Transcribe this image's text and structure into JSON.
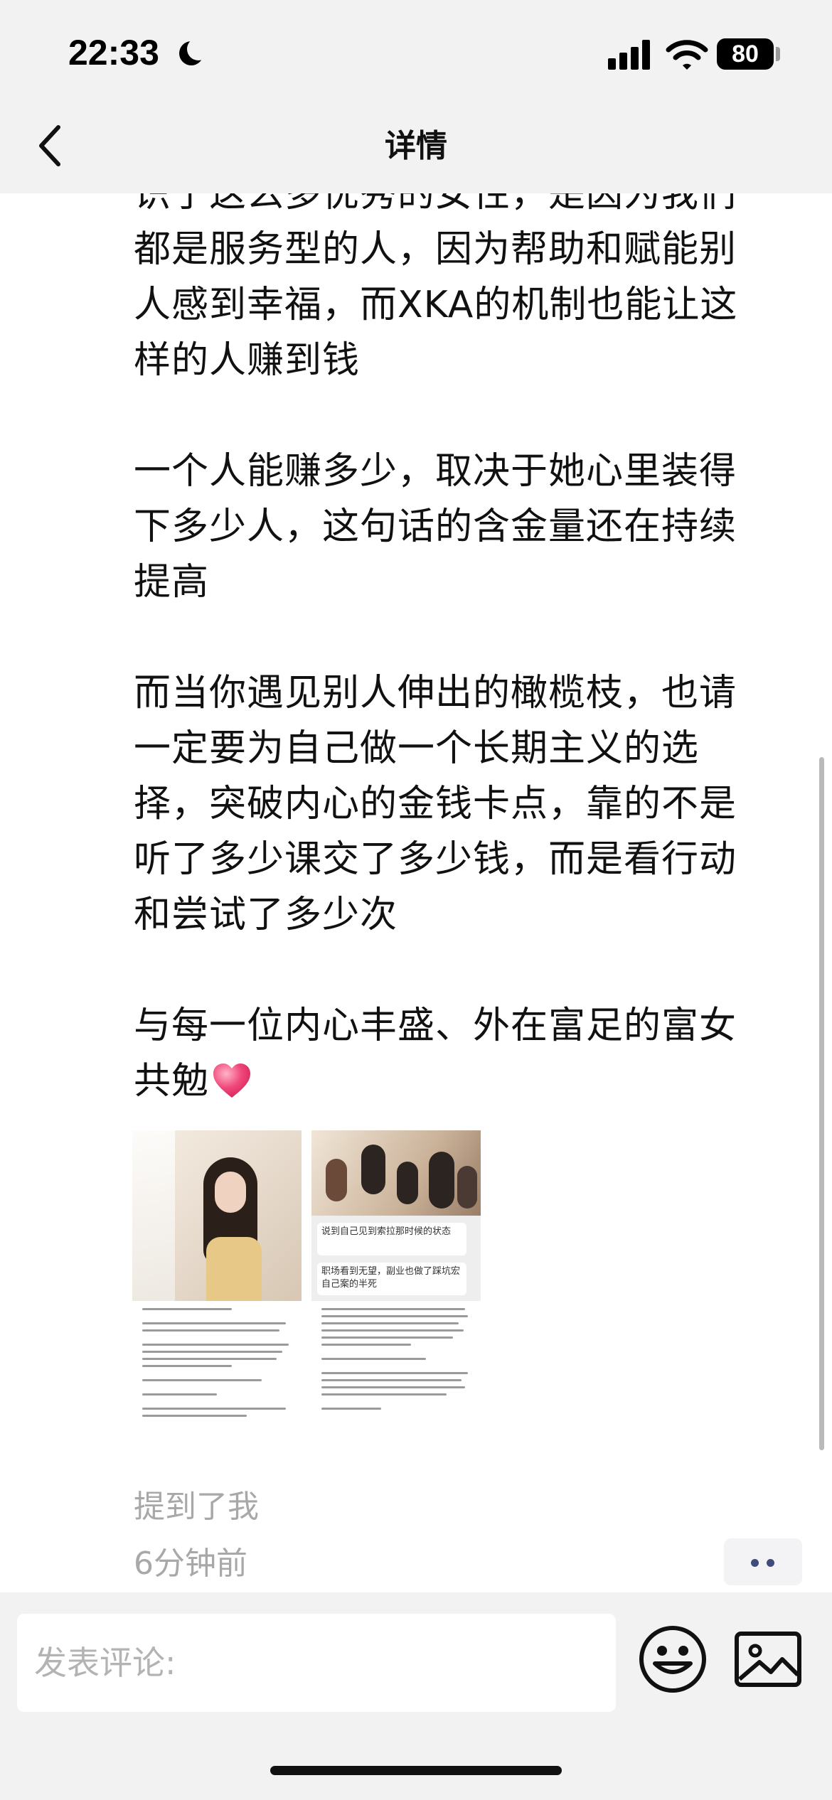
{
  "status_bar": {
    "time": "22:33",
    "battery": "80",
    "icons": [
      "moon-icon",
      "signal-icon",
      "wifi-icon",
      "battery-icon"
    ]
  },
  "header": {
    "title": "详情",
    "back_icon": "chevron-left-icon"
  },
  "post": {
    "paragraphs": [
      "识了这么多优秀的女性，是因为我们\n都是服务型的人，因为帮助和赋能别\n人感到幸福，而XKA的机制也能让这\n样的人赚到钱",
      "一个人能赚多少，取决于她心里装得\n下多少人，这句话的含金量还在持续\n提高",
      "而当你遇见别人伸出的橄榄枝，也请\n一定要为自己做一个长期主义的选\n择，突破内心的金钱卡点，靠的不是\n听了多少课交了多少钱，而是看行动\n和尝试了多少次",
      "与每一位内心丰盛、外在富足的富女\n共勉"
    ],
    "heart_emoji": "heart-icon",
    "image_bubbles": [
      "说到自己见到索拉那时候的状态",
      "职场看到无望，副业也做了踩坑宏自己案的半死"
    ],
    "mention": "提到了我",
    "time_ago": "6分钟前"
  },
  "comment_bar": {
    "placeholder": "发表评论:",
    "emoji_icon": "smiley-icon",
    "image_icon": "image-icon"
  },
  "colors": {
    "header_bg": "#f2f2f2",
    "text": "#111111",
    "meta": "#a8a8a8",
    "accent_dots": "#3f4b78",
    "heart": "#f0487a"
  }
}
